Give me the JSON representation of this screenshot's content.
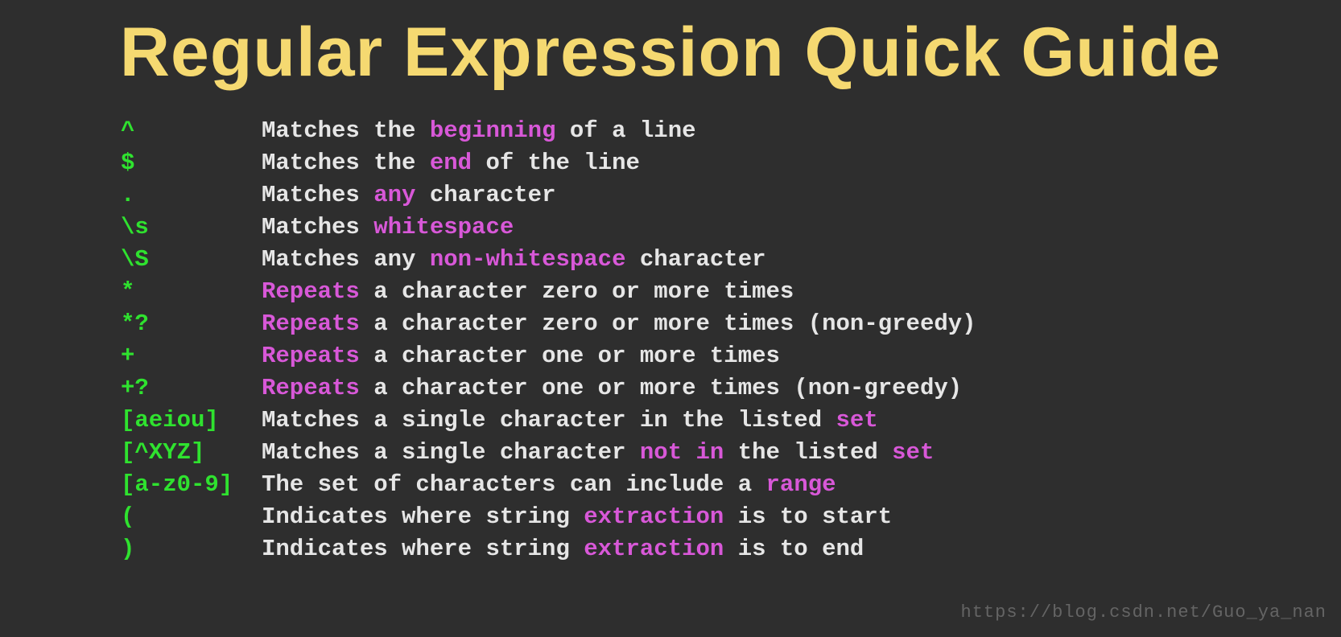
{
  "title": "Regular Expression Quick Guide",
  "rows": [
    {
      "symbol": "^",
      "parts": [
        "Matches the ",
        {
          "hl": "beginning"
        },
        " of a line"
      ]
    },
    {
      "symbol": "$",
      "parts": [
        "Matches the ",
        {
          "hl": "end"
        },
        " of the line"
      ]
    },
    {
      "symbol": ".",
      "parts": [
        "Matches ",
        {
          "hl": "any"
        },
        " character"
      ]
    },
    {
      "symbol": "\\s",
      "parts": [
        "Matches ",
        {
          "hl": "whitespace"
        }
      ]
    },
    {
      "symbol": "\\S",
      "parts": [
        "Matches any ",
        {
          "hl": "non-whitespace"
        },
        " character"
      ]
    },
    {
      "symbol": "*",
      "parts": [
        {
          "hl": "Repeats"
        },
        " a character zero or more times"
      ]
    },
    {
      "symbol": "*?",
      "parts": [
        {
          "hl": "Repeats"
        },
        " a character zero or more times (non-greedy)"
      ]
    },
    {
      "symbol": "+",
      "parts": [
        {
          "hl": "Repeats"
        },
        " a character one or more times"
      ]
    },
    {
      "symbol": "+?",
      "parts": [
        {
          "hl": "Repeats"
        },
        " a character one or more times (non-greedy)"
      ]
    },
    {
      "symbol": "[aeiou]",
      "parts": [
        "Matches a single character in the listed ",
        {
          "hl": "set"
        }
      ]
    },
    {
      "symbol": "[^XYZ]",
      "parts": [
        "Matches a single character ",
        {
          "hl": "not in"
        },
        " the listed ",
        {
          "hl": "set"
        }
      ]
    },
    {
      "symbol": "[a-z0-9]",
      "parts": [
        "The set of characters can include a ",
        {
          "hl": "range"
        }
      ]
    },
    {
      "symbol": "(",
      "parts": [
        "Indicates where string ",
        {
          "hl": "extraction"
        },
        " is to start"
      ]
    },
    {
      "symbol": ")",
      "parts": [
        "Indicates where string ",
        {
          "hl": "extraction"
        },
        " is to end"
      ]
    }
  ],
  "watermark": "https://blog.csdn.net/Guo_ya_nan"
}
